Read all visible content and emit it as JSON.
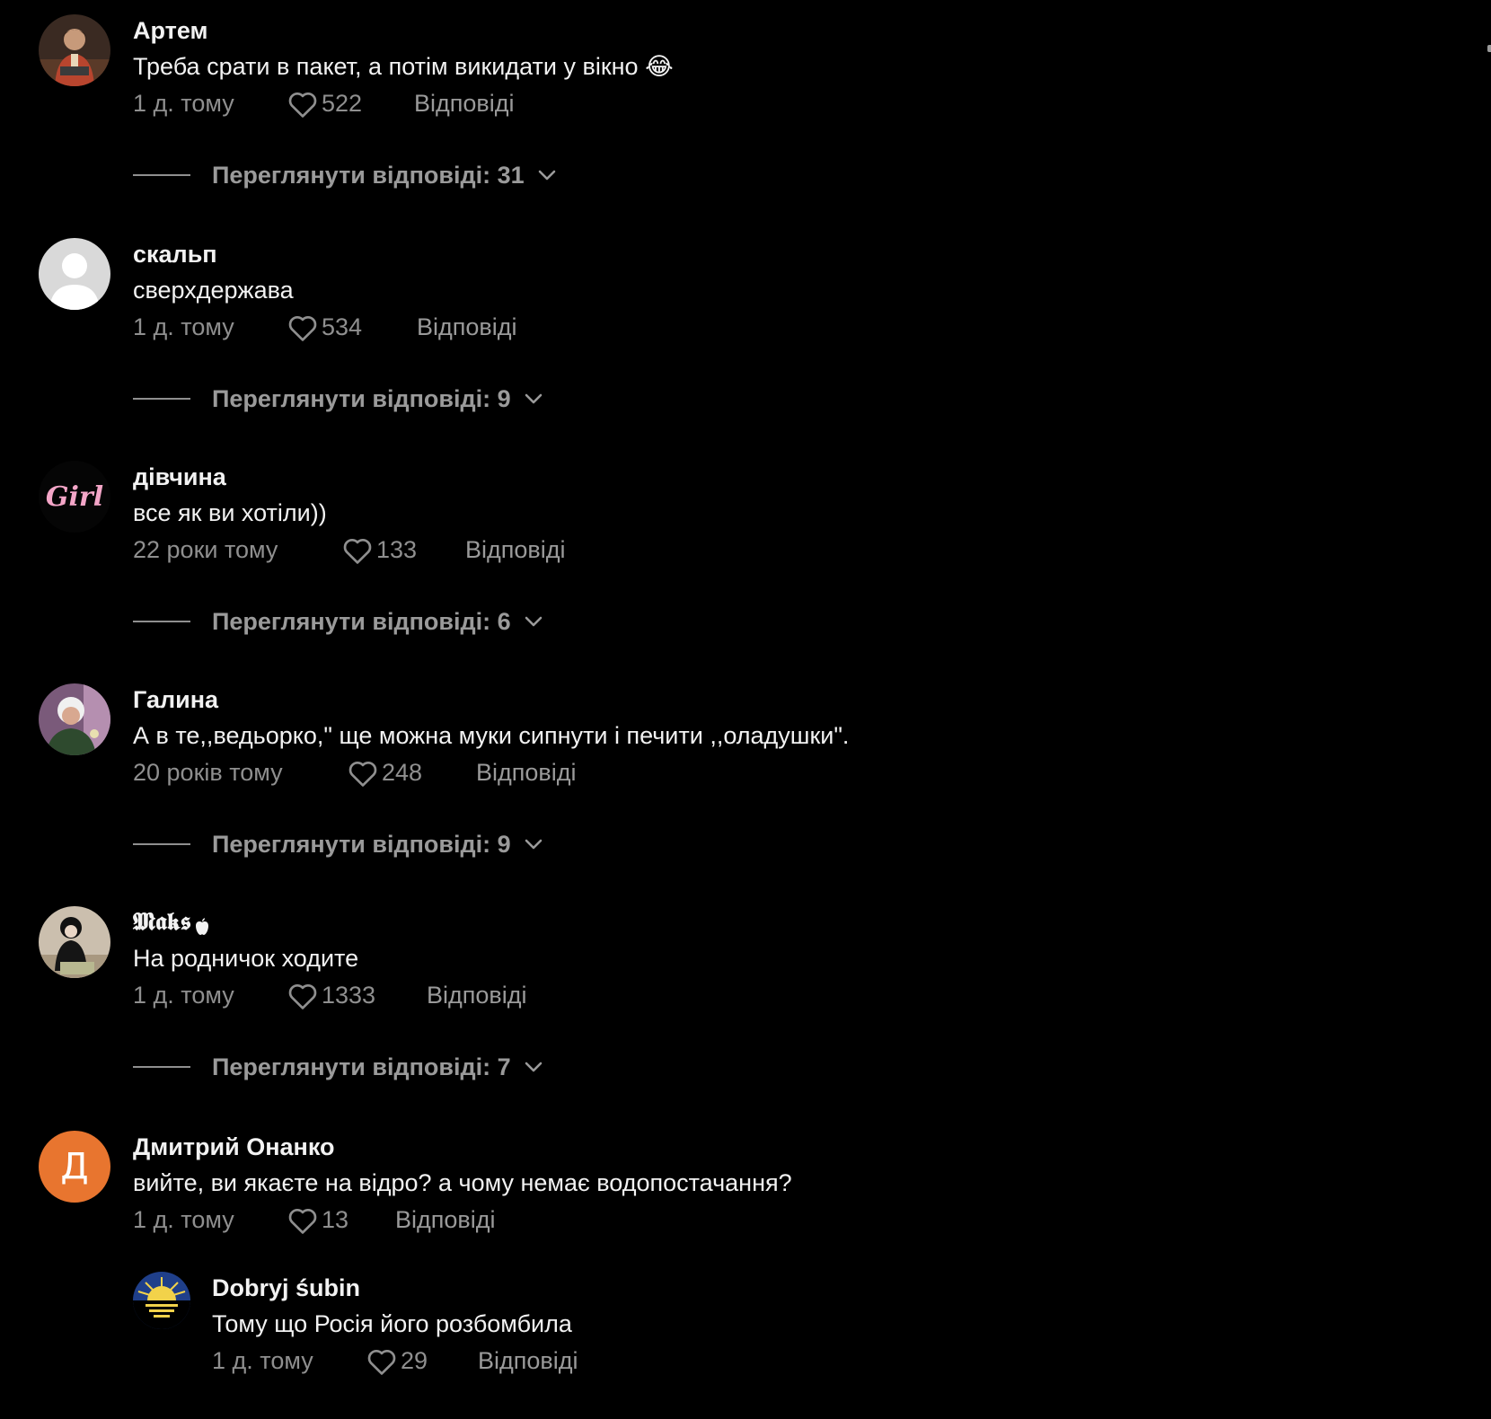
{
  "colors": {
    "background": "#000000",
    "primary_text": "#f2f2f2",
    "secondary_text": "#8f8f8f",
    "avatar_orange": "#e8752f"
  },
  "comments": [
    {
      "author": "Артем",
      "text": "Треба срати в пакет, а потім викидати у вікно 😂",
      "time": "1 д. тому",
      "likes": "522",
      "reply_label": "Відповіді",
      "view_replies": "Переглянути відповіді: 31",
      "avatar_icon": "user-photo-avatar"
    },
    {
      "author": "скальп",
      "text": "сверхдержава",
      "time": "1 д. тому",
      "likes": "534",
      "reply_label": "Відповіді",
      "view_replies": "Переглянути відповіді: 9",
      "avatar_icon": "default-avatar"
    },
    {
      "author": "дівчина",
      "text": "все як ви хотіли))",
      "time": "22 роки тому",
      "likes": "133",
      "reply_label": "Відповіді",
      "view_replies": "Переглянути відповіді: 6",
      "avatar_icon": "girl-logo-avatar",
      "avatar_text": "Girl"
    },
    {
      "author": "Галина",
      "text": "А в те,,ведьорко,\" ще можна муки сипнути і печити ,,оладушки\".",
      "time": "20 років тому",
      "likes": "248",
      "reply_label": "Відповіді",
      "view_replies": "Переглянути відповіді: 9",
      "avatar_icon": "user-photo-avatar"
    },
    {
      "author": "𝕸𝖆𝖐𝖘 ",
      "text": "На родничок ходите",
      "time": "1 д. тому",
      "likes": "1333",
      "reply_label": "Відповіді",
      "view_replies": "Переглянути відповіді: 7",
      "avatar_icon": "user-photo-avatar",
      "author_badge_icon": "apple-icon"
    },
    {
      "author": "Дмитрий Онанко",
      "text": "вийте, ви якаєте на відро? а чому немає водопостачання?",
      "time": "1 д. тому",
      "likes": "13",
      "reply_label": "Відповіді",
      "avatar_icon": "letter-avatar",
      "avatar_letter": "Д"
    }
  ],
  "reply": {
    "author": "Dobryj śubin",
    "text": "Тому що Росія його розбомбила",
    "time": "1 д. тому",
    "likes": "29",
    "reply_label": "Відповіді",
    "avatar_icon": "sunrise-flag-avatar"
  },
  "icons": {
    "like": "heart-outline-icon",
    "expand": "chevron-down-icon"
  }
}
